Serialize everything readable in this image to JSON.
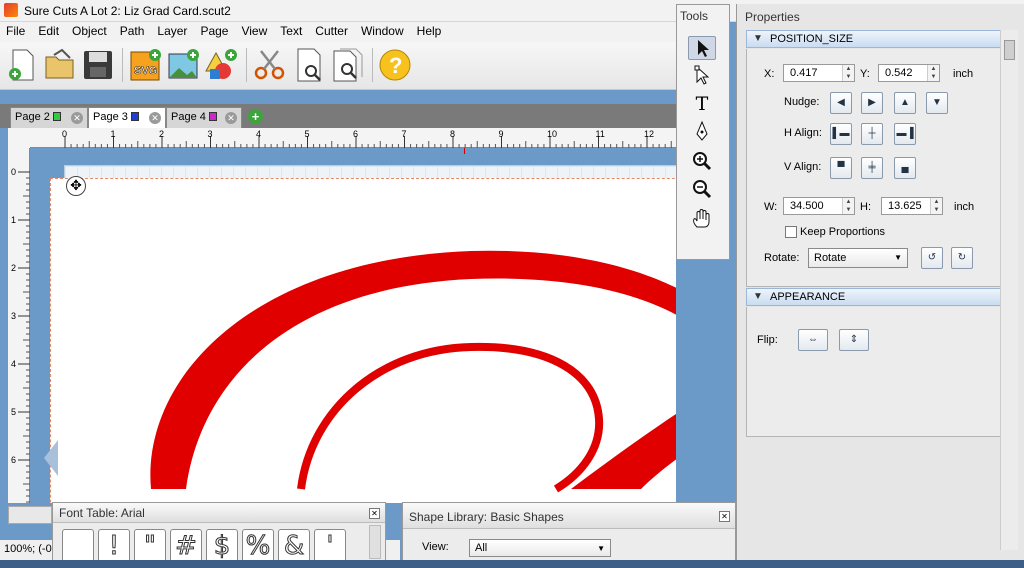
{
  "window": {
    "title": "Sure Cuts A Lot 2: Liz Grad Card.scut2"
  },
  "menu": [
    "File",
    "Edit",
    "Object",
    "Path",
    "Layer",
    "Page",
    "View",
    "Text",
    "Cutter",
    "Window",
    "Help"
  ],
  "toolbar": {
    "buttons": [
      "new-document-icon",
      "open-icon",
      "save-icon",
      "import-svg-icon",
      "import-image-icon",
      "add-shape-icon",
      "cut-icon",
      "preview-icon",
      "print-preview-icon",
      "help-icon"
    ],
    "svg_label": "SVG"
  },
  "tabs": [
    {
      "label": "Page 2",
      "color": "#2ecc40"
    },
    {
      "label": "Page 3",
      "color": "#1f3fd8"
    },
    {
      "label": "Page 4",
      "color": "#c92bc9"
    }
  ],
  "ruler": {
    "h_ticks": [
      "0",
      "1",
      "2",
      "3",
      "4",
      "5",
      "6",
      "7",
      "8",
      "9",
      "10",
      "11",
      "12"
    ],
    "v_ticks": [
      "0",
      "1",
      "2",
      "3",
      "4",
      "5",
      "6"
    ]
  },
  "status": {
    "text": "100%; (-0"
  },
  "tools": {
    "title": "Tools",
    "items": [
      "select-tool-icon",
      "node-edit-tool-icon",
      "text-tool-icon",
      "pen-tool-icon",
      "zoom-in-icon",
      "zoom-out-icon",
      "pan-hand-icon"
    ],
    "text_glyph": "T"
  },
  "properties": {
    "title": "Properties",
    "position_size": {
      "header": "POSITION_SIZE",
      "x_label": "X:",
      "x_value": "0.417",
      "y_label": "Y:",
      "y_value": "0.542",
      "unit": "inch",
      "nudge_label": "Nudge:",
      "h_align_label": "H Align:",
      "v_align_label": "V Align:",
      "w_label": "W:",
      "w_value": "34.500",
      "h_label": "H:",
      "h_value": "13.625",
      "keep_proportions_label": "Keep Proportions",
      "keep_proportions_checked": false,
      "rotate_label": "Rotate:",
      "rotate_value": "Rotate"
    },
    "appearance": {
      "header": "APPEARANCE",
      "flip_label": "Flip:"
    }
  },
  "font_table": {
    "title": "Font Table: Arial",
    "glyphs": [
      "",
      "!",
      "\"",
      "#",
      "$",
      "%",
      "&",
      "'"
    ]
  },
  "shape_library": {
    "title": "Shape Library: Basic Shapes",
    "view_label": "View:",
    "view_value": "All"
  },
  "colors": {
    "accent": "#e00000",
    "workspace": "#6b9ac9"
  }
}
